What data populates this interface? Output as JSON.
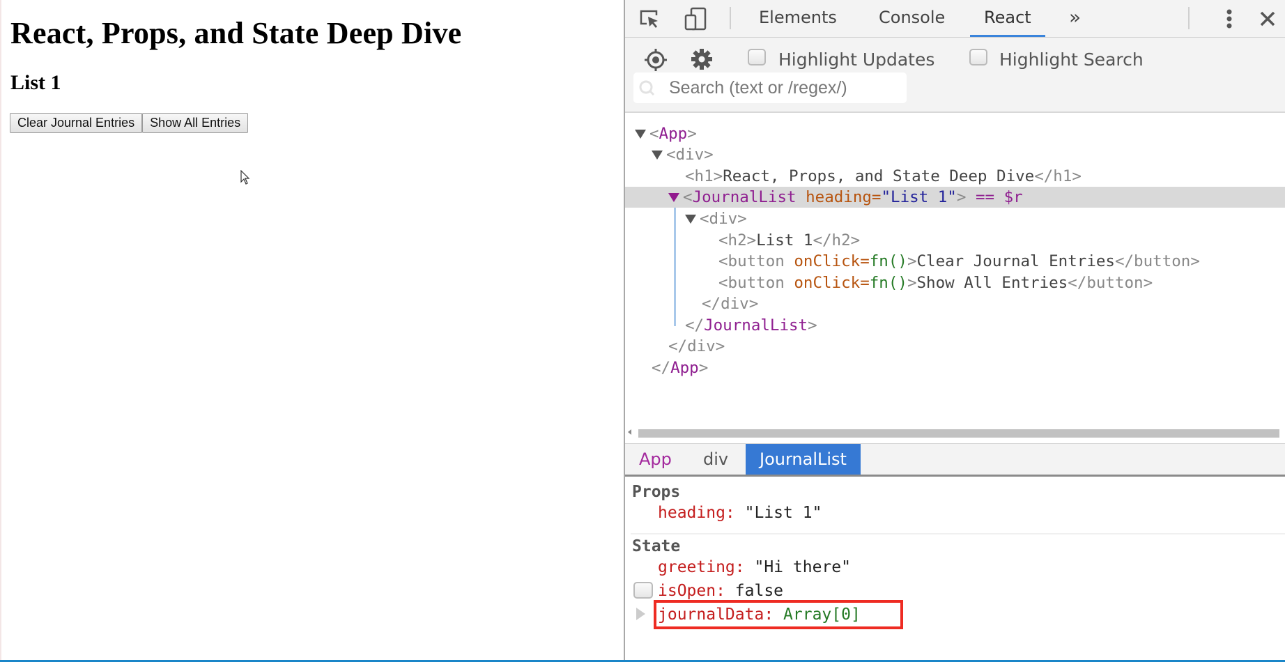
{
  "page": {
    "title": "React, Props, and State Deep Dive",
    "subtitle": "List 1",
    "buttons": [
      "Clear Journal Entries",
      "Show All Entries"
    ]
  },
  "devtools": {
    "toolbar": {
      "icons": [
        "inspect-element-icon",
        "device-toggle-icon"
      ],
      "tabs": [
        {
          "label": "Elements",
          "active": false
        },
        {
          "label": "Console",
          "active": false
        },
        {
          "label": "React",
          "active": true
        }
      ],
      "overflow": "»",
      "menu_icon": "kebab-menu-icon",
      "close_icon": "close-icon"
    },
    "react_toolbar": {
      "highlight_updates": {
        "label": "Highlight Updates",
        "checked": false
      },
      "highlight_search": {
        "label": "Highlight Search",
        "checked": false
      },
      "search_placeholder": "Search (text or /regex/)"
    },
    "tree": {
      "app_open": "<",
      "app_name": "App",
      "gt": ">",
      "div_open": "<div>",
      "h1_open": "<h1>",
      "h1_text": "React, Props, and State Deep Dive",
      "h1_close": "</h1>",
      "jl_lt": "<",
      "jl_name": "JournalList",
      "jl_attr": " heading=",
      "jl_val": "\"List 1\"",
      "jl_gt": ">",
      "jl_ref": " == $r",
      "div2_open": "<div>",
      "h2_open": "<h2>",
      "h2_text": "List 1",
      "h2_close": "</h2>",
      "btn_open": "<button ",
      "btn_attr": "onClick=",
      "btn_fn": "fn()",
      "btn_gt": ">",
      "btn1_text": "Clear Journal Entries",
      "btn2_text": "Show All Entries",
      "btn_close": "</button>",
      "div2_close": "</div>",
      "jl_close_lt": "</",
      "div_close": "</div>",
      "app_close_lt": "</"
    },
    "breadcrumbs": [
      {
        "label": "App",
        "active": false
      },
      {
        "label": "div",
        "active": false
      },
      {
        "label": "JournalList",
        "active": true
      }
    ],
    "props": {
      "header": "Props",
      "items": [
        {
          "key": "heading:",
          "value": "\"List 1\""
        }
      ]
    },
    "state": {
      "header": "State",
      "greeting": {
        "key": "greeting:",
        "value": "\"Hi there\""
      },
      "isOpen": {
        "key": "isOpen:",
        "value": "false",
        "checked": false
      },
      "journalData": {
        "key": "journalData:",
        "value": "Array[0]"
      }
    }
  }
}
